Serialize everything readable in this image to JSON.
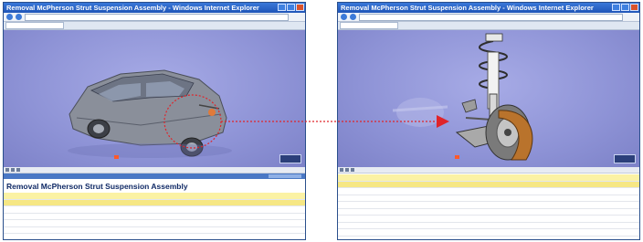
{
  "left_window": {
    "title": "Removal McPherson Strut Suspension Assembly - Windows Internet Explorer",
    "url": "",
    "tab": "",
    "toolbar_text": "",
    "doc_title": "Removal McPherson Strut Suspension Assembly",
    "doc_header": "",
    "rows": [
      {
        "num": "",
        "text": "",
        "style": "hl"
      },
      {
        "num": "",
        "text": "",
        "style": "hl2"
      },
      {
        "num": "",
        "text": "",
        "style": ""
      },
      {
        "num": "",
        "text": "",
        "style": ""
      },
      {
        "num": "",
        "text": "",
        "style": ""
      },
      {
        "num": "",
        "text": "",
        "style": ""
      },
      {
        "num": "",
        "text": "",
        "style": ""
      },
      {
        "num": "",
        "text": "",
        "style": ""
      }
    ]
  },
  "right_window": {
    "title": "Removal McPherson Strut Suspension Assembly - Windows Internet Explorer",
    "url": "",
    "tab": "",
    "toolbar_text": "",
    "doc_header": "",
    "rows": [
      {
        "num": "",
        "text": "",
        "style": "hl"
      },
      {
        "num": "",
        "text": "",
        "style": "hl2"
      },
      {
        "num": "",
        "text": "",
        "style": ""
      },
      {
        "num": "",
        "text": "",
        "style": ""
      },
      {
        "num": "",
        "text": "",
        "style": ""
      },
      {
        "num": "",
        "text": "",
        "style": ""
      },
      {
        "num": "",
        "text": "",
        "style": ""
      },
      {
        "num": "",
        "text": "",
        "style": ""
      },
      {
        "num": "",
        "text": "",
        "style": ""
      },
      {
        "num": "",
        "text": "",
        "style": ""
      }
    ]
  },
  "colors": {
    "viewport_bg": "#9296d9",
    "highlight_row": "#fbf2a4",
    "callout_red": "#e0242a",
    "title_bar": "#1f55b8",
    "brake_caliper": "#b9732c"
  },
  "icons": [
    "car-model-image",
    "suspension-strut-image",
    "callout-arrow-icon"
  ]
}
